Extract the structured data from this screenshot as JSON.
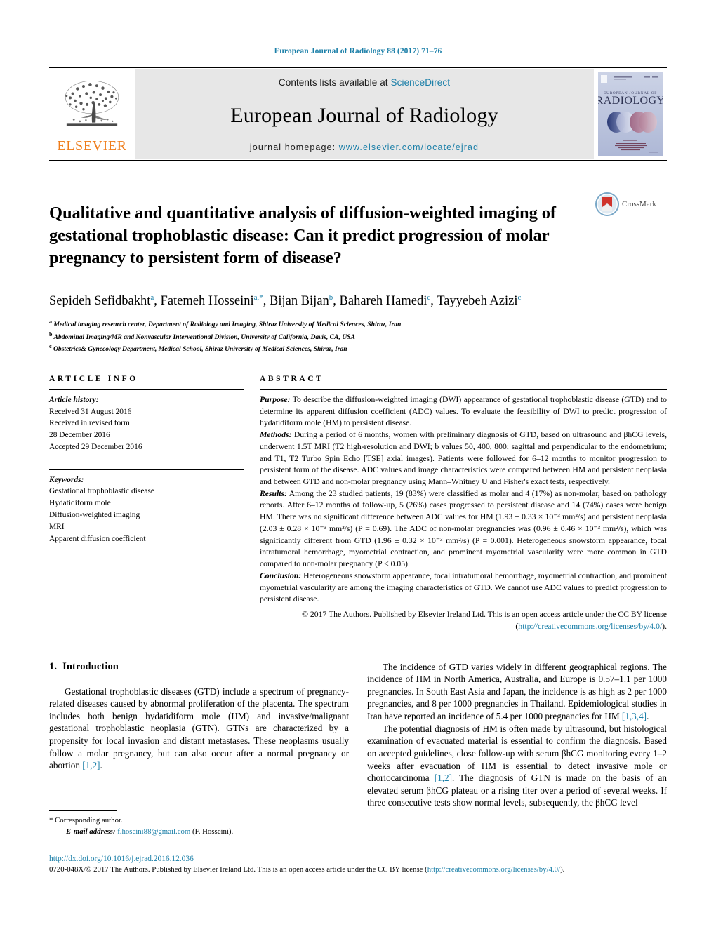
{
  "running_head": "European Journal of Radiology 88 (2017) 71–76",
  "masthead": {
    "publisher_name": "ELSEVIER",
    "contents_prefix": "Contents lists available at ",
    "contents_link": "ScienceDirect",
    "journal_title": "European Journal of Radiology",
    "homepage_prefix": "journal homepage: ",
    "homepage_url": "www.elsevier.com/locate/ejrad",
    "cover_title": "RADIOLOGY",
    "cover_supertitle": "EUROPEAN JOURNAL OF"
  },
  "article": {
    "title": "Qualitative and quantitative analysis of diffusion-weighted imaging of gestational trophoblastic disease: Can it predict progression of molar pregnancy to persistent form of disease?",
    "crossmark_label": "CrossMark",
    "authors_line1": "Sepideh Sefidbakht",
    "authors": [
      {
        "name": "Sepideh Sefidbakht",
        "sup": "a"
      },
      {
        "name": "Fatemeh Hosseini",
        "sup": "a,*"
      },
      {
        "name": "Bijan Bijan",
        "sup": "b"
      },
      {
        "name": "Bahareh Hamedi",
        "sup": "c"
      },
      {
        "name": "Tayyebeh Azizi",
        "sup": "c"
      }
    ],
    "affiliations": [
      {
        "mark": "a",
        "text": "Medical imaging research center, Department of Radiology and Imaging, Shiraz University of Medical Sciences, Shiraz, Iran"
      },
      {
        "mark": "b",
        "text": "Abdominal Imaging/MR and Nonvascular Interventional Division, University of California, Davis, CA, USA"
      },
      {
        "mark": "c",
        "text": "Obstetrics& Gynecology Department, Medical School, Shiraz University of Medical Sciences, Shiraz, Iran"
      }
    ]
  },
  "article_info": {
    "heading": "ARTICLE INFO",
    "history_label": "Article history:",
    "history_lines": [
      "Received 31 August 2016",
      "Received in revised form",
      "28 December 2016",
      "Accepted 29 December 2016"
    ],
    "keywords_label": "Keywords:",
    "keywords": [
      "Gestational trophoblastic disease",
      "Hydatidiform mole",
      "Diffusion-weighted imaging",
      "MRI",
      "Apparent diffusion coefficient"
    ]
  },
  "abstract": {
    "heading": "ABSTRACT",
    "purpose_label": "Purpose:",
    "purpose_text": " To describe the diffusion-weighted imaging (DWI) appearance of gestational trophoblastic disease (GTD) and to determine its apparent diffusion coefficient (ADC) values. To evaluate the feasibility of DWI to predict progression of hydatidiform mole (HM) to persistent disease.",
    "methods_label": "Methods:",
    "methods_text": " During a period of 6 months, women with preliminary diagnosis of GTD, based on ultrasound and βhCG levels, underwent 1.5T MRI (T2 high-resolution and DWI; b values 50, 400, 800; sagittal and perpendicular to the endometrium; and T1, T2 Turbo Spin Echo [TSE] axial images). Patients were followed for 6–12 months to monitor progression to persistent form of the disease. ADC values and image characteristics were compared between HM and persistent neoplasia and between GTD and non-molar pregnancy using Mann–Whitney U and Fisher's exact tests, respectively.",
    "results_label": "Results:",
    "results_text": " Among the 23 studied patients, 19 (83%) were classified as molar and 4 (17%) as non-molar, based on pathology reports. After 6–12 months of follow-up, 5 (26%) cases progressed to persistent disease and 14 (74%) cases were benign HM. There was no significant difference between ADC values for HM (1.93 ± 0.33 × 10⁻³ mm²/s) and persistent neoplasia (2.03 ± 0.28 × 10⁻³ mm²/s) (P = 0.69). The ADC of non-molar pregnancies was (0.96 ± 0.46 × 10⁻³ mm²/s), which was significantly different from GTD (1.96 ± 0.32 × 10⁻³ mm²/s) (P = 0.001). Heterogeneous snowstorm appearance, focal intratumoral hemorrhage, myometrial contraction, and prominent myometrial vascularity were more common in GTD compared to non-molar pregnancy (P < 0.05).",
    "conclusion_label": "Conclusion:",
    "conclusion_text": " Heterogeneous snowstorm appearance, focal intratumoral hemorrhage, myometrial contraction, and prominent myometrial vascularity are among the imaging characteristics of GTD. We cannot use ADC values to predict progression to persistent disease.",
    "copyright_text": "© 2017 The Authors. Published by Elsevier Ireland Ltd. This is an open access article under the CC BY license (",
    "copyright_link": "http://creativecommons.org/licenses/by/4.0/",
    "copyright_tail": ")."
  },
  "introduction": {
    "section_number": "1.",
    "section_title": "Introduction",
    "left_para_1_a": "Gestational trophoblastic diseases (GTD) include a spectrum of pregnancy-related diseases caused by abnormal proliferation of the placenta. The spectrum includes both benign hydatidiform mole (HM) and invasive/malignant gestational trophoblastic neoplasia (GTN). GTNs are characterized by a propensity for local invasion and distant metastases. These neoplasms usually follow a molar pregnancy, but can also occur after a normal pregnancy or abortion ",
    "left_para_1_ref": "[1,2]",
    "left_para_1_b": ".",
    "right_para_1_a": "The incidence of GTD varies widely in different geographical regions. The incidence of HM in North America, Australia, and Europe is 0.57–1.1 per 1000 pregnancies. In South East Asia and Japan, the incidence is as high as 2 per 1000 pregnancies, and 8 per 1000 pregnancies in Thailand. Epidemiological studies in Iran have reported an incidence of 5.4 per 1000 pregnancies for HM ",
    "right_para_1_ref": "[1,3,4]",
    "right_para_1_b": ".",
    "right_para_2_a": "The potential diagnosis of HM is often made by ultrasound, but histological examination of evacuated material is essential to confirm the diagnosis. Based on accepted guidelines, close follow-up with serum βhCG monitoring every 1–2 weeks after evacuation of HM is essential to detect invasive mole or choriocarcinoma ",
    "right_para_2_ref": "[1,2]",
    "right_para_2_b": ". The diagnosis of GTN is made on the basis of an elevated serum βhCG plateau or a rising titer over a period of several weeks. If three consecutive tests show normal levels, subsequently, the βhCG level"
  },
  "footnote": {
    "corresponding_marker": "*",
    "corresponding_text": "Corresponding author.",
    "email_label": "E-mail address:",
    "email": "f.hoseini88@gmail.com",
    "email_owner": "(F. Hosseini)."
  },
  "page_footer": {
    "doi": "http://dx.doi.org/10.1016/j.ejrad.2016.12.036",
    "issn_text": "0720-048X/© 2017 The Authors. Published by Elsevier Ireland Ltd. This is an open access article under the CC BY license (",
    "license_link": "http://creativecommons.org/licenses/by/4.0/",
    "issn_tail": ").",
    "accent_color": "#1b7fa8",
    "elsevier_orange": "#ef7c1a"
  }
}
